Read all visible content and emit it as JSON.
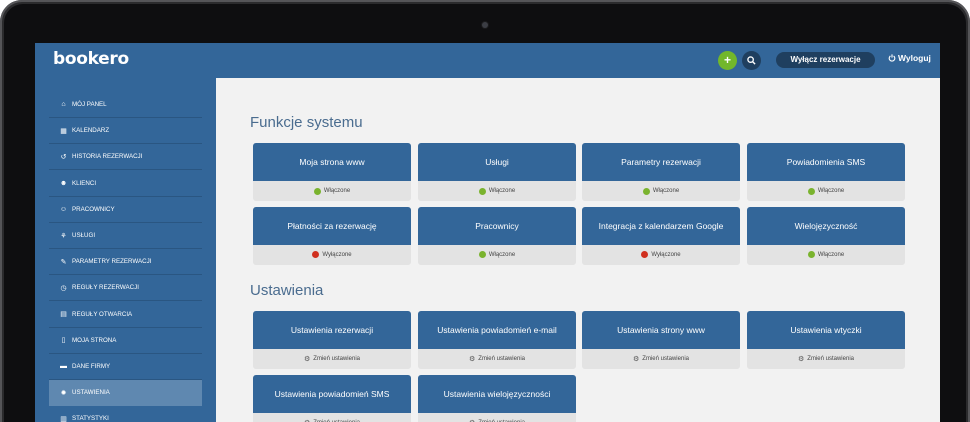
{
  "app": {
    "logo": "bookero",
    "add_label": "+",
    "disable_reservations": "Wyłącz rezerwacje",
    "logout": "Wyloguj"
  },
  "sidebar": {
    "items": [
      {
        "label": "MÓJ PANEL",
        "icon": "home-icon",
        "glyph": "⌂"
      },
      {
        "label": "KALENDARZ",
        "icon": "calendar-icon",
        "glyph": "▦"
      },
      {
        "label": "HISTORIA REZERWACJI",
        "icon": "history-icon",
        "glyph": "↺"
      },
      {
        "label": "KLIENCI",
        "icon": "users-icon",
        "glyph": "☻"
      },
      {
        "label": "PRACOWNICY",
        "icon": "staff-icon",
        "glyph": "☺"
      },
      {
        "label": "USŁUGI",
        "icon": "services-icon",
        "glyph": "⚘"
      },
      {
        "label": "PARAMETRY REZERWACJI",
        "icon": "wrench-icon",
        "glyph": "✎"
      },
      {
        "label": "REGUŁY REZERWACJI",
        "icon": "clock-icon",
        "glyph": "◷"
      },
      {
        "label": "REGUŁY OTWARCIA",
        "icon": "schedule-icon",
        "glyph": "▤"
      },
      {
        "label": "MOJA STRONA",
        "icon": "page-icon",
        "glyph": "▯"
      },
      {
        "label": "DANE FIRMY",
        "icon": "company-icon",
        "glyph": "▬"
      },
      {
        "label": "USTAWIENIA",
        "icon": "gear-icon",
        "glyph": "✹",
        "active": true
      },
      {
        "label": "STATYSTYKI",
        "icon": "stats-icon",
        "glyph": "▥"
      }
    ]
  },
  "features": {
    "title": "Funkcje systemu",
    "cards": [
      {
        "label": "Moja strona www",
        "status": "Włączone",
        "status_color": "#7ab32e"
      },
      {
        "label": "Usługi",
        "status": "Włączone",
        "status_color": "#7ab32e"
      },
      {
        "label": "Parametry rezerwacji",
        "status": "Włączone",
        "status_color": "#7ab32e"
      },
      {
        "label": "Powiadomienia SMS",
        "status": "Włączone",
        "status_color": "#7ab32e"
      },
      {
        "label": "Płatności za rezerwację",
        "status": "Wyłączone",
        "status_color": "#d0301f"
      },
      {
        "label": "Pracownicy",
        "status": "Włączone",
        "status_color": "#7ab32e"
      },
      {
        "label": "Integracja z kalendarzem Google",
        "status": "Wyłączone",
        "status_color": "#d0301f"
      },
      {
        "label": "Wielojęzyczność",
        "status": "Włączone",
        "status_color": "#7ab32e"
      }
    ]
  },
  "settings": {
    "title": "Ustawienia",
    "change_label": "Zmień ustawienia",
    "cards": [
      {
        "label": "Ustawienia rezerwacji"
      },
      {
        "label": "Ustawienia powiadomień e-mail"
      },
      {
        "label": "Ustawienia strony www"
      },
      {
        "label": "Ustawienia wtyczki"
      },
      {
        "label": "Ustawienia powiadomień SMS"
      },
      {
        "label": "Ustawienia wielojęzyczności"
      }
    ]
  },
  "colors": {
    "brand": "#336699",
    "sidebar_active": "#5f88b0",
    "accent_green": "#72b72b",
    "dark_button": "#1f3f5f"
  }
}
